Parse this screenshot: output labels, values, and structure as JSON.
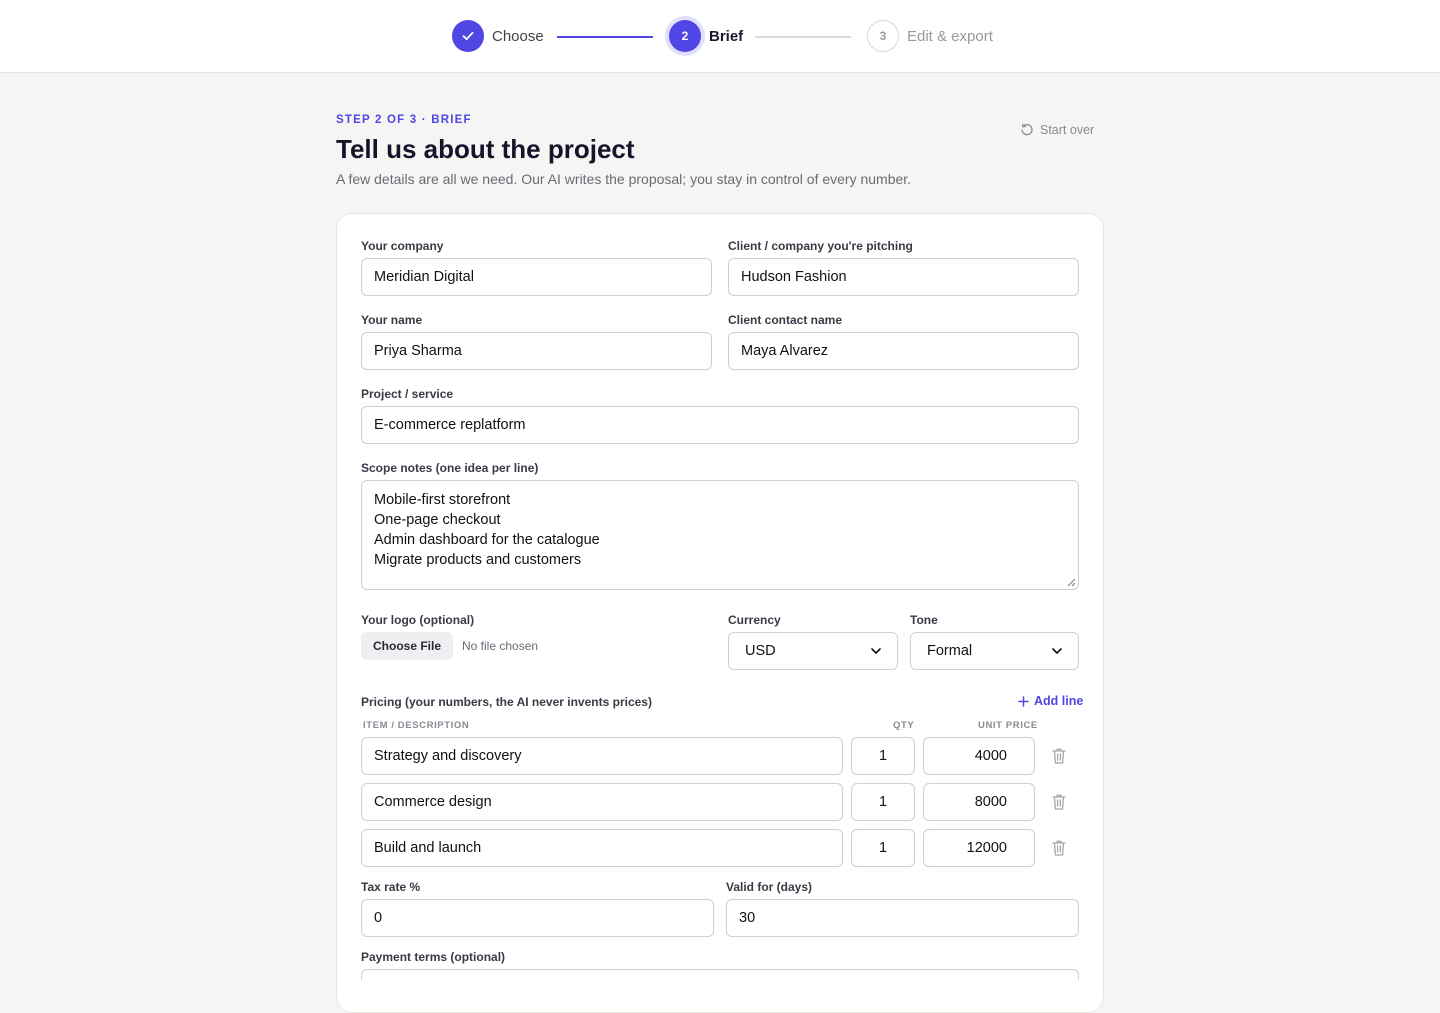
{
  "stepper": {
    "steps": [
      {
        "number": "",
        "label": "Choose",
        "state": "complete"
      },
      {
        "number": "2",
        "label": "Brief",
        "state": "active"
      },
      {
        "number": "3",
        "label": "Edit & export",
        "state": "upcoming"
      }
    ]
  },
  "header": {
    "eyebrow": "STEP 2 OF 3 · BRIEF",
    "title": "Tell us about the project",
    "subtitle": "A few details are all we need. Our AI writes the proposal; you stay in control of every number.",
    "start_over_label": "Start over"
  },
  "form": {
    "your_company": {
      "label": "Your company",
      "value": "Meridian Digital"
    },
    "client_company": {
      "label": "Client / company you're pitching",
      "value": "Hudson Fashion"
    },
    "your_name": {
      "label": "Your name",
      "value": "Priya Sharma"
    },
    "client_contact": {
      "label": "Client contact name",
      "value": "Maya Alvarez"
    },
    "project": {
      "label": "Project / service",
      "value": "E-commerce replatform"
    },
    "scope": {
      "label": "Scope notes (one idea per line)",
      "lines": [
        "Mobile-first storefront",
        "One-page checkout",
        "Admin dashboard for the catalogue",
        "Migrate products and customers"
      ]
    },
    "logo": {
      "label": "Your logo (optional)",
      "button_label": "Choose File",
      "status": "No file chosen"
    },
    "currency": {
      "label": "Currency",
      "value": "USD"
    },
    "tone": {
      "label": "Tone",
      "value": "Formal"
    },
    "pricing": {
      "label": "Pricing (your numbers, the AI never invents prices)",
      "add_line_label": "Add line",
      "columns": {
        "item": "ITEM / DESCRIPTION",
        "qty": "QTY",
        "unit_price": "UNIT PRICE"
      },
      "rows": [
        {
          "item": "Strategy and discovery",
          "qty": "1",
          "unit_price": "4000"
        },
        {
          "item": "Commerce design",
          "qty": "1",
          "unit_price": "8000"
        },
        {
          "item": "Build and launch",
          "qty": "1",
          "unit_price": "12000"
        }
      ]
    },
    "tax_rate": {
      "label": "Tax rate %",
      "value": "0"
    },
    "valid_for": {
      "label": "Valid for (days)",
      "value": "30"
    },
    "payment_terms": {
      "label": "Payment terms (optional)",
      "value": ""
    }
  },
  "colors": {
    "accent": "#4f46e5",
    "page_bg": "#f5f5f3",
    "card_bg": "#ffffff"
  }
}
